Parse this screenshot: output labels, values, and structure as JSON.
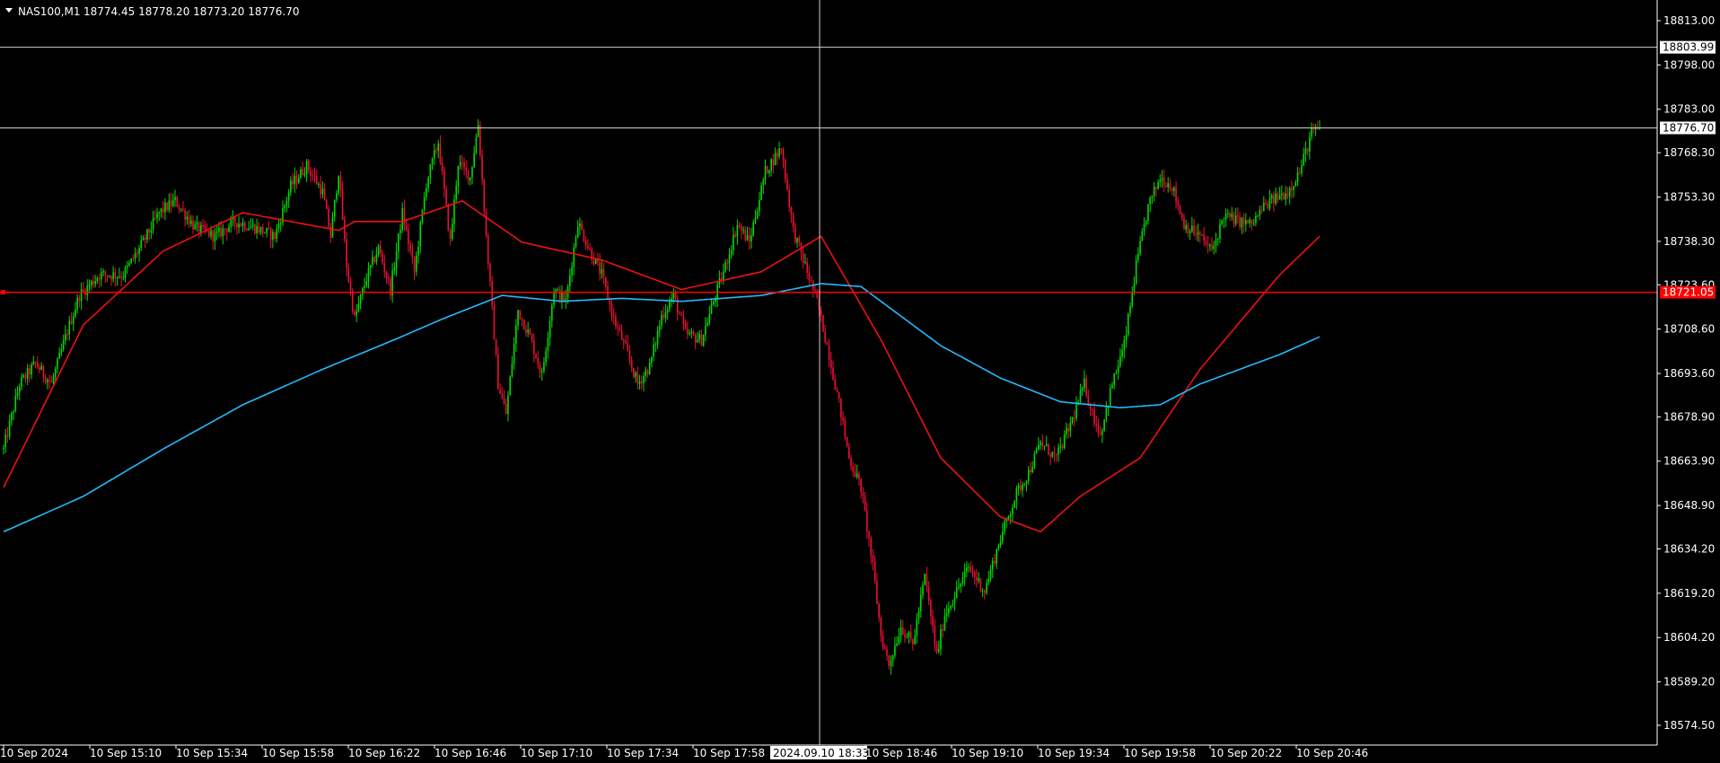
{
  "header": {
    "symbol": "NAS100,M1",
    "ohlc": "18774.45 18778.20 18773.20 18776.70"
  },
  "colors": {
    "background": "#000000",
    "bull": "#00dd00",
    "bear": "#ee1133",
    "ma_fast": "#ee1111",
    "ma_slow": "#22bbff",
    "grid": "#d0d0d0",
    "level_line": "#ff0000"
  },
  "chart_data": {
    "type": "candlestick",
    "symbol": "NAS100",
    "timeframe": "M1",
    "y_ticks": [
      "18813.00",
      "18798.00",
      "18783.00",
      "18768.30",
      "18753.30",
      "18738.30",
      "18723.60",
      "18708.60",
      "18693.60",
      "18678.90",
      "18663.90",
      "18648.90",
      "18634.20",
      "18619.20",
      "18604.20",
      "18589.20",
      "18574.50"
    ],
    "ylim": [
      18570,
      18818
    ],
    "x_ticks": [
      "10 Sep 2024",
      "10 Sep 15:10",
      "10 Sep 15:34",
      "10 Sep 15:58",
      "10 Sep 16:22",
      "10 Sep 16:46",
      "10 Sep 17:10",
      "10 Sep 17:34",
      "10 Sep 17:58",
      "2024.09.10 18:33",
      "10 Sep 18:46",
      "10 Sep 19:10",
      "10 Sep 19:34",
      "10 Sep 19:58",
      "10 Sep 20:22",
      "10 Sep 20:46"
    ],
    "crosshair": {
      "time": "2024.09.10 18:33",
      "price": "18803.99"
    },
    "current_price": "18776.70",
    "horizontal_level": "18721.05",
    "close_anchors": [
      [
        0,
        18668
      ],
      [
        8,
        18690
      ],
      [
        16,
        18697
      ],
      [
        24,
        18690
      ],
      [
        32,
        18708
      ],
      [
        38,
        18720
      ],
      [
        48,
        18727
      ],
      [
        60,
        18727
      ],
      [
        70,
        18738
      ],
      [
        78,
        18748
      ],
      [
        86,
        18752
      ],
      [
        96,
        18743
      ],
      [
        106,
        18740
      ],
      [
        116,
        18745
      ],
      [
        126,
        18743
      ],
      [
        136,
        18740
      ],
      [
        144,
        18757
      ],
      [
        152,
        18764
      ],
      [
        160,
        18755
      ],
      [
        164,
        18740
      ],
      [
        168,
        18762
      ],
      [
        172,
        18730
      ],
      [
        176,
        18712
      ],
      [
        182,
        18726
      ],
      [
        188,
        18736
      ],
      [
        194,
        18722
      ],
      [
        200,
        18748
      ],
      [
        206,
        18728
      ],
      [
        212,
        18758
      ],
      [
        218,
        18772
      ],
      [
        224,
        18738
      ],
      [
        228,
        18765
      ],
      [
        234,
        18760
      ],
      [
        238,
        18778
      ],
      [
        242,
        18740
      ],
      [
        248,
        18690
      ],
      [
        252,
        18680
      ],
      [
        258,
        18715
      ],
      [
        264,
        18706
      ],
      [
        270,
        18693
      ],
      [
        276,
        18722
      ],
      [
        282,
        18718
      ],
      [
        288,
        18745
      ],
      [
        294,
        18735
      ],
      [
        300,
        18727
      ],
      [
        306,
        18712
      ],
      [
        312,
        18702
      ],
      [
        318,
        18690
      ],
      [
        324,
        18696
      ],
      [
        330,
        18713
      ],
      [
        336,
        18720
      ],
      [
        342,
        18707
      ],
      [
        350,
        18705
      ],
      [
        356,
        18718
      ],
      [
        362,
        18730
      ],
      [
        368,
        18744
      ],
      [
        374,
        18738
      ],
      [
        382,
        18762
      ],
      [
        390,
        18770
      ],
      [
        396,
        18742
      ],
      [
        402,
        18730
      ],
      [
        408,
        18718
      ],
      [
        414,
        18700
      ],
      [
        420,
        18680
      ],
      [
        424,
        18665
      ],
      [
        430,
        18655
      ],
      [
        436,
        18628
      ],
      [
        440,
        18605
      ],
      [
        444,
        18595
      ],
      [
        450,
        18608
      ],
      [
        456,
        18602
      ],
      [
        462,
        18625
      ],
      [
        468,
        18598
      ],
      [
        472,
        18612
      ],
      [
        478,
        18620
      ],
      [
        484,
        18628
      ],
      [
        492,
        18620
      ],
      [
        500,
        18638
      ],
      [
        508,
        18653
      ],
      [
        514,
        18660
      ],
      [
        520,
        18670
      ],
      [
        528,
        18665
      ],
      [
        536,
        18678
      ],
      [
        542,
        18690
      ],
      [
        546,
        18680
      ],
      [
        550,
        18673
      ],
      [
        556,
        18690
      ],
      [
        562,
        18703
      ],
      [
        568,
        18730
      ],
      [
        574,
        18750
      ],
      [
        580,
        18760
      ],
      [
        586,
        18757
      ],
      [
        592,
        18744
      ],
      [
        600,
        18740
      ],
      [
        606,
        18735
      ],
      [
        612,
        18747
      ],
      [
        620,
        18745
      ],
      [
        626,
        18744
      ],
      [
        632,
        18750
      ],
      [
        638,
        18753
      ],
      [
        644,
        18755
      ],
      [
        650,
        18762
      ],
      [
        656,
        18775
      ],
      [
        660,
        18776.7
      ]
    ],
    "ma_fast_anchors": [
      [
        0,
        18655
      ],
      [
        40,
        18710
      ],
      [
        80,
        18735
      ],
      [
        120,
        18748
      ],
      [
        168,
        18742
      ],
      [
        176,
        18745
      ],
      [
        200,
        18745
      ],
      [
        230,
        18752
      ],
      [
        260,
        18738
      ],
      [
        300,
        18732
      ],
      [
        340,
        18722
      ],
      [
        380,
        18728
      ],
      [
        410,
        18740
      ],
      [
        440,
        18705
      ],
      [
        470,
        18665
      ],
      [
        500,
        18645
      ],
      [
        520,
        18640
      ],
      [
        540,
        18652
      ],
      [
        570,
        18665
      ],
      [
        600,
        18695
      ],
      [
        640,
        18727
      ],
      [
        660,
        18740
      ]
    ],
    "ma_slow_anchors": [
      [
        0,
        18640
      ],
      [
        40,
        18652
      ],
      [
        80,
        18668
      ],
      [
        120,
        18683
      ],
      [
        160,
        18695
      ],
      [
        196,
        18705
      ],
      [
        220,
        18712
      ],
      [
        250,
        18720
      ],
      [
        280,
        18718
      ],
      [
        310,
        18719
      ],
      [
        340,
        18718
      ],
      [
        380,
        18720
      ],
      [
        410,
        18724
      ],
      [
        430,
        18723
      ],
      [
        470,
        18703
      ],
      [
        500,
        18692
      ],
      [
        530,
        18684
      ],
      [
        560,
        18682
      ],
      [
        580,
        18683
      ],
      [
        600,
        18690
      ],
      [
        640,
        18700
      ],
      [
        660,
        18706
      ]
    ]
  }
}
